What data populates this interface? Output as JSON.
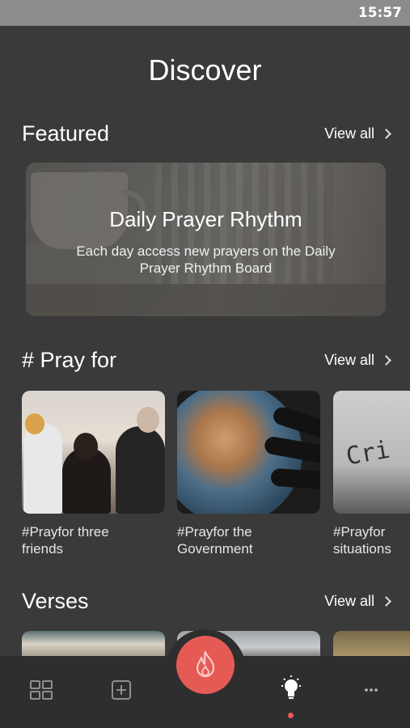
{
  "status_bar": {
    "time": "15:57"
  },
  "page": {
    "title": "Discover"
  },
  "featured": {
    "section_title": "Featured",
    "view_all": "View all",
    "card": {
      "title": "Daily Prayer Rhythm",
      "description": "Each day access new prayers on the Daily Prayer Rhythm Board"
    }
  },
  "pray_for": {
    "section_title": "# Pray for",
    "view_all": "View all",
    "items": [
      {
        "label": "#Prayfor three\nfriends"
      },
      {
        "label": "#Prayfor the\nGovernment"
      },
      {
        "label": "#Prayfor\nsituations"
      }
    ],
    "crisis_img_text": "Cri"
  },
  "verses": {
    "section_title": "Verses",
    "view_all": "View all"
  },
  "bottom_nav": {
    "items": [
      "grid-icon",
      "add-square-icon",
      "flame-icon",
      "lightbulb-icon",
      "more-icon"
    ],
    "active": "lightbulb-icon",
    "accent": "#e65a56"
  }
}
